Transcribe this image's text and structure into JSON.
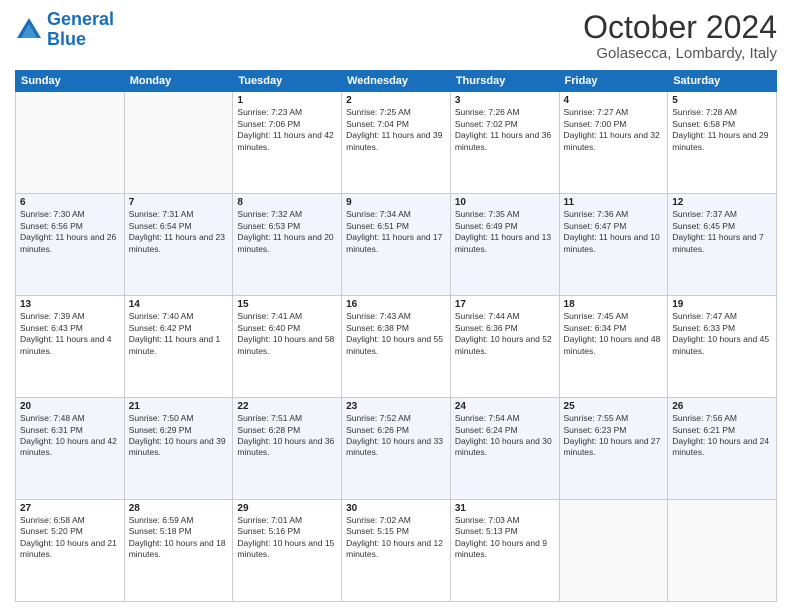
{
  "logo": {
    "line1": "General",
    "line2": "Blue"
  },
  "title": "October 2024",
  "location": "Golasecca, Lombardy, Italy",
  "weekdays": [
    "Sunday",
    "Monday",
    "Tuesday",
    "Wednesday",
    "Thursday",
    "Friday",
    "Saturday"
  ],
  "rows": [
    [
      {
        "day": "",
        "sunrise": "",
        "sunset": "",
        "daylight": ""
      },
      {
        "day": "",
        "sunrise": "",
        "sunset": "",
        "daylight": ""
      },
      {
        "day": "1",
        "sunrise": "Sunrise: 7:23 AM",
        "sunset": "Sunset: 7:06 PM",
        "daylight": "Daylight: 11 hours and 42 minutes."
      },
      {
        "day": "2",
        "sunrise": "Sunrise: 7:25 AM",
        "sunset": "Sunset: 7:04 PM",
        "daylight": "Daylight: 11 hours and 39 minutes."
      },
      {
        "day": "3",
        "sunrise": "Sunrise: 7:26 AM",
        "sunset": "Sunset: 7:02 PM",
        "daylight": "Daylight: 11 hours and 36 minutes."
      },
      {
        "day": "4",
        "sunrise": "Sunrise: 7:27 AM",
        "sunset": "Sunset: 7:00 PM",
        "daylight": "Daylight: 11 hours and 32 minutes."
      },
      {
        "day": "5",
        "sunrise": "Sunrise: 7:28 AM",
        "sunset": "Sunset: 6:58 PM",
        "daylight": "Daylight: 11 hours and 29 minutes."
      }
    ],
    [
      {
        "day": "6",
        "sunrise": "Sunrise: 7:30 AM",
        "sunset": "Sunset: 6:56 PM",
        "daylight": "Daylight: 11 hours and 26 minutes."
      },
      {
        "day": "7",
        "sunrise": "Sunrise: 7:31 AM",
        "sunset": "Sunset: 6:54 PM",
        "daylight": "Daylight: 11 hours and 23 minutes."
      },
      {
        "day": "8",
        "sunrise": "Sunrise: 7:32 AM",
        "sunset": "Sunset: 6:53 PM",
        "daylight": "Daylight: 11 hours and 20 minutes."
      },
      {
        "day": "9",
        "sunrise": "Sunrise: 7:34 AM",
        "sunset": "Sunset: 6:51 PM",
        "daylight": "Daylight: 11 hours and 17 minutes."
      },
      {
        "day": "10",
        "sunrise": "Sunrise: 7:35 AM",
        "sunset": "Sunset: 6:49 PM",
        "daylight": "Daylight: 11 hours and 13 minutes."
      },
      {
        "day": "11",
        "sunrise": "Sunrise: 7:36 AM",
        "sunset": "Sunset: 6:47 PM",
        "daylight": "Daylight: 11 hours and 10 minutes."
      },
      {
        "day": "12",
        "sunrise": "Sunrise: 7:37 AM",
        "sunset": "Sunset: 6:45 PM",
        "daylight": "Daylight: 11 hours and 7 minutes."
      }
    ],
    [
      {
        "day": "13",
        "sunrise": "Sunrise: 7:39 AM",
        "sunset": "Sunset: 6:43 PM",
        "daylight": "Daylight: 11 hours and 4 minutes."
      },
      {
        "day": "14",
        "sunrise": "Sunrise: 7:40 AM",
        "sunset": "Sunset: 6:42 PM",
        "daylight": "Daylight: 11 hours and 1 minute."
      },
      {
        "day": "15",
        "sunrise": "Sunrise: 7:41 AM",
        "sunset": "Sunset: 6:40 PM",
        "daylight": "Daylight: 10 hours and 58 minutes."
      },
      {
        "day": "16",
        "sunrise": "Sunrise: 7:43 AM",
        "sunset": "Sunset: 6:38 PM",
        "daylight": "Daylight: 10 hours and 55 minutes."
      },
      {
        "day": "17",
        "sunrise": "Sunrise: 7:44 AM",
        "sunset": "Sunset: 6:36 PM",
        "daylight": "Daylight: 10 hours and 52 minutes."
      },
      {
        "day": "18",
        "sunrise": "Sunrise: 7:45 AM",
        "sunset": "Sunset: 6:34 PM",
        "daylight": "Daylight: 10 hours and 48 minutes."
      },
      {
        "day": "19",
        "sunrise": "Sunrise: 7:47 AM",
        "sunset": "Sunset: 6:33 PM",
        "daylight": "Daylight: 10 hours and 45 minutes."
      }
    ],
    [
      {
        "day": "20",
        "sunrise": "Sunrise: 7:48 AM",
        "sunset": "Sunset: 6:31 PM",
        "daylight": "Daylight: 10 hours and 42 minutes."
      },
      {
        "day": "21",
        "sunrise": "Sunrise: 7:50 AM",
        "sunset": "Sunset: 6:29 PM",
        "daylight": "Daylight: 10 hours and 39 minutes."
      },
      {
        "day": "22",
        "sunrise": "Sunrise: 7:51 AM",
        "sunset": "Sunset: 6:28 PM",
        "daylight": "Daylight: 10 hours and 36 minutes."
      },
      {
        "day": "23",
        "sunrise": "Sunrise: 7:52 AM",
        "sunset": "Sunset: 6:26 PM",
        "daylight": "Daylight: 10 hours and 33 minutes."
      },
      {
        "day": "24",
        "sunrise": "Sunrise: 7:54 AM",
        "sunset": "Sunset: 6:24 PM",
        "daylight": "Daylight: 10 hours and 30 minutes."
      },
      {
        "day": "25",
        "sunrise": "Sunrise: 7:55 AM",
        "sunset": "Sunset: 6:23 PM",
        "daylight": "Daylight: 10 hours and 27 minutes."
      },
      {
        "day": "26",
        "sunrise": "Sunrise: 7:56 AM",
        "sunset": "Sunset: 6:21 PM",
        "daylight": "Daylight: 10 hours and 24 minutes."
      }
    ],
    [
      {
        "day": "27",
        "sunrise": "Sunrise: 6:58 AM",
        "sunset": "Sunset: 5:20 PM",
        "daylight": "Daylight: 10 hours and 21 minutes."
      },
      {
        "day": "28",
        "sunrise": "Sunrise: 6:59 AM",
        "sunset": "Sunset: 5:18 PM",
        "daylight": "Daylight: 10 hours and 18 minutes."
      },
      {
        "day": "29",
        "sunrise": "Sunrise: 7:01 AM",
        "sunset": "Sunset: 5:16 PM",
        "daylight": "Daylight: 10 hours and 15 minutes."
      },
      {
        "day": "30",
        "sunrise": "Sunrise: 7:02 AM",
        "sunset": "Sunset: 5:15 PM",
        "daylight": "Daylight: 10 hours and 12 minutes."
      },
      {
        "day": "31",
        "sunrise": "Sunrise: 7:03 AM",
        "sunset": "Sunset: 5:13 PM",
        "daylight": "Daylight: 10 hours and 9 minutes."
      },
      {
        "day": "",
        "sunrise": "",
        "sunset": "",
        "daylight": ""
      },
      {
        "day": "",
        "sunrise": "",
        "sunset": "",
        "daylight": ""
      }
    ]
  ]
}
